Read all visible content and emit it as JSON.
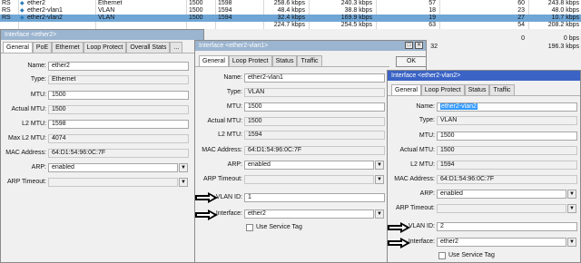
{
  "table": {
    "rows": [
      {
        "flag": "RS",
        "name": "ether2",
        "type": "Ethernet",
        "mtu": "1500",
        "l2mtu": "1598",
        "tx": "258.6 kbps",
        "rx": "240.3 kbps",
        "fp": "57",
        "fr": "60",
        "fb": "243.8 kbps"
      },
      {
        "flag": "RS",
        "name": "ether2-vlan1",
        "type": "VLAN",
        "mtu": "1500",
        "l2mtu": "1594",
        "tx": "48.4 kbps",
        "rx": "38.8 kbps",
        "fp": "18",
        "fr": "23",
        "fb": "48.0 kbps"
      },
      {
        "flag": "RS",
        "name": "ether2-vlan2",
        "type": "VLAN",
        "mtu": "1500",
        "l2mtu": "1594",
        "tx": "32.4 kbps",
        "rx": "169.9 kbps",
        "fp": "19",
        "fr": "27",
        "fb": "10.7 kbps"
      },
      {
        "flag": "",
        "name": "",
        "type": "",
        "mtu": "",
        "l2mtu": "",
        "tx": "224.7 kbps",
        "rx": "254.5 kbps",
        "fp": "63",
        "fr": "54",
        "fb": "208.2 kbps"
      },
      {
        "flag": "",
        "name": "",
        "type": "",
        "mtu": "",
        "l2mtu": "",
        "tx": "",
        "rx": "",
        "fp": "",
        "fr": "0",
        "fb": "0 bps"
      },
      {
        "flag": "",
        "name": "",
        "type": "",
        "mtu": "",
        "l2mtu": "",
        "tx": "",
        "rx": "",
        "fp": "32",
        "fr": "",
        "fb": "196.3 kbps"
      }
    ]
  },
  "win1": {
    "title": "Interface <ether2>",
    "tabs": [
      "General",
      "PoE",
      "Ethernet",
      "Loop Protect",
      "Overall Stats",
      "..."
    ],
    "fields": {
      "name_label": "Name:",
      "name": "ether2",
      "type_label": "Type:",
      "type": "Ethernet",
      "mtu_label": "MTU:",
      "mtu": "1500",
      "actual_mtu_label": "Actual MTU:",
      "actual_mtu": "1500",
      "l2mtu_label": "L2 MTU:",
      "l2mtu": "1598",
      "max_l2mtu_label": "Max L2 MTU:",
      "max_l2mtu": "4074",
      "mac_label": "MAC Address:",
      "mac": "64:D1:54:96:0C:7F",
      "arp_label": "ARP:",
      "arp": "enabled",
      "arp_timeout_label": "ARP Timeout:",
      "arp_timeout": ""
    }
  },
  "win2": {
    "title": "Interface <ether2-vlan1>",
    "tabs": [
      "General",
      "Loop Protect",
      "Status",
      "Traffic"
    ],
    "ok_label": "OK",
    "fields": {
      "name_label": "Name:",
      "name": "ether2-vlan1",
      "type_label": "Type:",
      "type": "VLAN",
      "mtu_label": "MTU:",
      "mtu": "1500",
      "actual_mtu_label": "Actual MTU:",
      "actual_mtu": "1500",
      "l2mtu_label": "L2 MTU:",
      "l2mtu": "1594",
      "mac_label": "MAC Address:",
      "mac": "64:D1:54:96:0C:7F",
      "arp_label": "ARP:",
      "arp": "enabled",
      "arp_timeout_label": "ARP Timeout:",
      "arp_timeout": "",
      "vlan_id_label": "VLAN ID:",
      "vlan_id": "1",
      "interface_label": "Interface:",
      "interface": "ether2",
      "service_tag_label": "Use Service Tag"
    }
  },
  "win3": {
    "title": "Interface <ether2-vlan2>",
    "tabs": [
      "General",
      "Loop Protect",
      "Status",
      "Traffic"
    ],
    "fields": {
      "name_label": "Name:",
      "name": "ether2-vlan2",
      "type_label": "Type:",
      "type": "VLAN",
      "mtu_label": "MTU:",
      "mtu": "1500",
      "actual_mtu_label": "Actual MTU:",
      "actual_mtu": "1500",
      "l2mtu_label": "L2 MTU:",
      "l2mtu": "1594",
      "mac_label": "MAC Address:",
      "mac": "64:D1:54:96:0C:7F",
      "arp_label": "ARP:",
      "arp": "enabled",
      "arp_timeout_label": "ARP Timeout:",
      "arp_timeout": "",
      "vlan_id_label": "VLAN ID:",
      "vlan_id": "2",
      "interface_label": "Interface:",
      "interface": "ether2",
      "service_tag_label": "Use Service Tag"
    }
  },
  "colors": {
    "active_title": "#3a63c5",
    "inactive_title": "#9bb4cf",
    "selected_row": "#6fa6d6",
    "highlight": "#3399ff"
  }
}
